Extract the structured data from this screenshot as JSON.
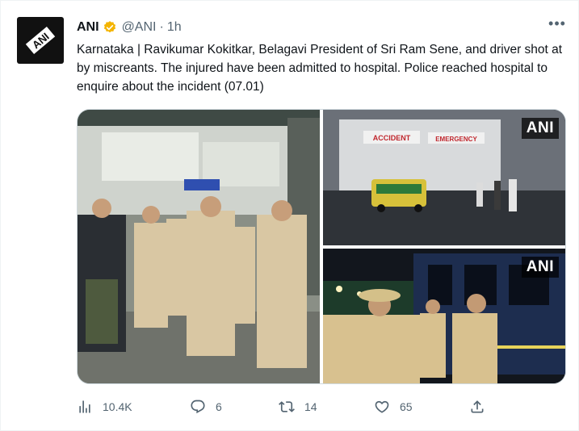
{
  "tweet": {
    "author_name": "ANI",
    "handle": "@ANI",
    "separator": "·",
    "time": "1h",
    "more_label": "•••",
    "text": "Karnataka | Ravikumar Kokitkar, Belagavi President of Sri Ram Sene, and driver shot at by miscreants. The injured have been admitted to hospital. Police reached hospital to enquire about the incident (07.01)",
    "avatar_text": "ANI",
    "media": [
      {
        "badge": "",
        "sign": ""
      },
      {
        "badge": "ANI",
        "sign_left": "ACCIDENT",
        "sign_right": "EMERGENCY"
      },
      {
        "badge": "ANI"
      }
    ],
    "stats": {
      "views": "10.4K",
      "replies": "6",
      "retweets": "14",
      "likes": "65"
    }
  },
  "colors": {
    "verified_badge": "#f4b400",
    "muted_text": "#536471",
    "primary_text": "#0f1419"
  },
  "icons": [
    "ani-logo-icon",
    "verified-badge-icon",
    "more-icon",
    "views-icon",
    "reply-icon",
    "retweet-icon",
    "like-icon",
    "share-icon"
  ]
}
